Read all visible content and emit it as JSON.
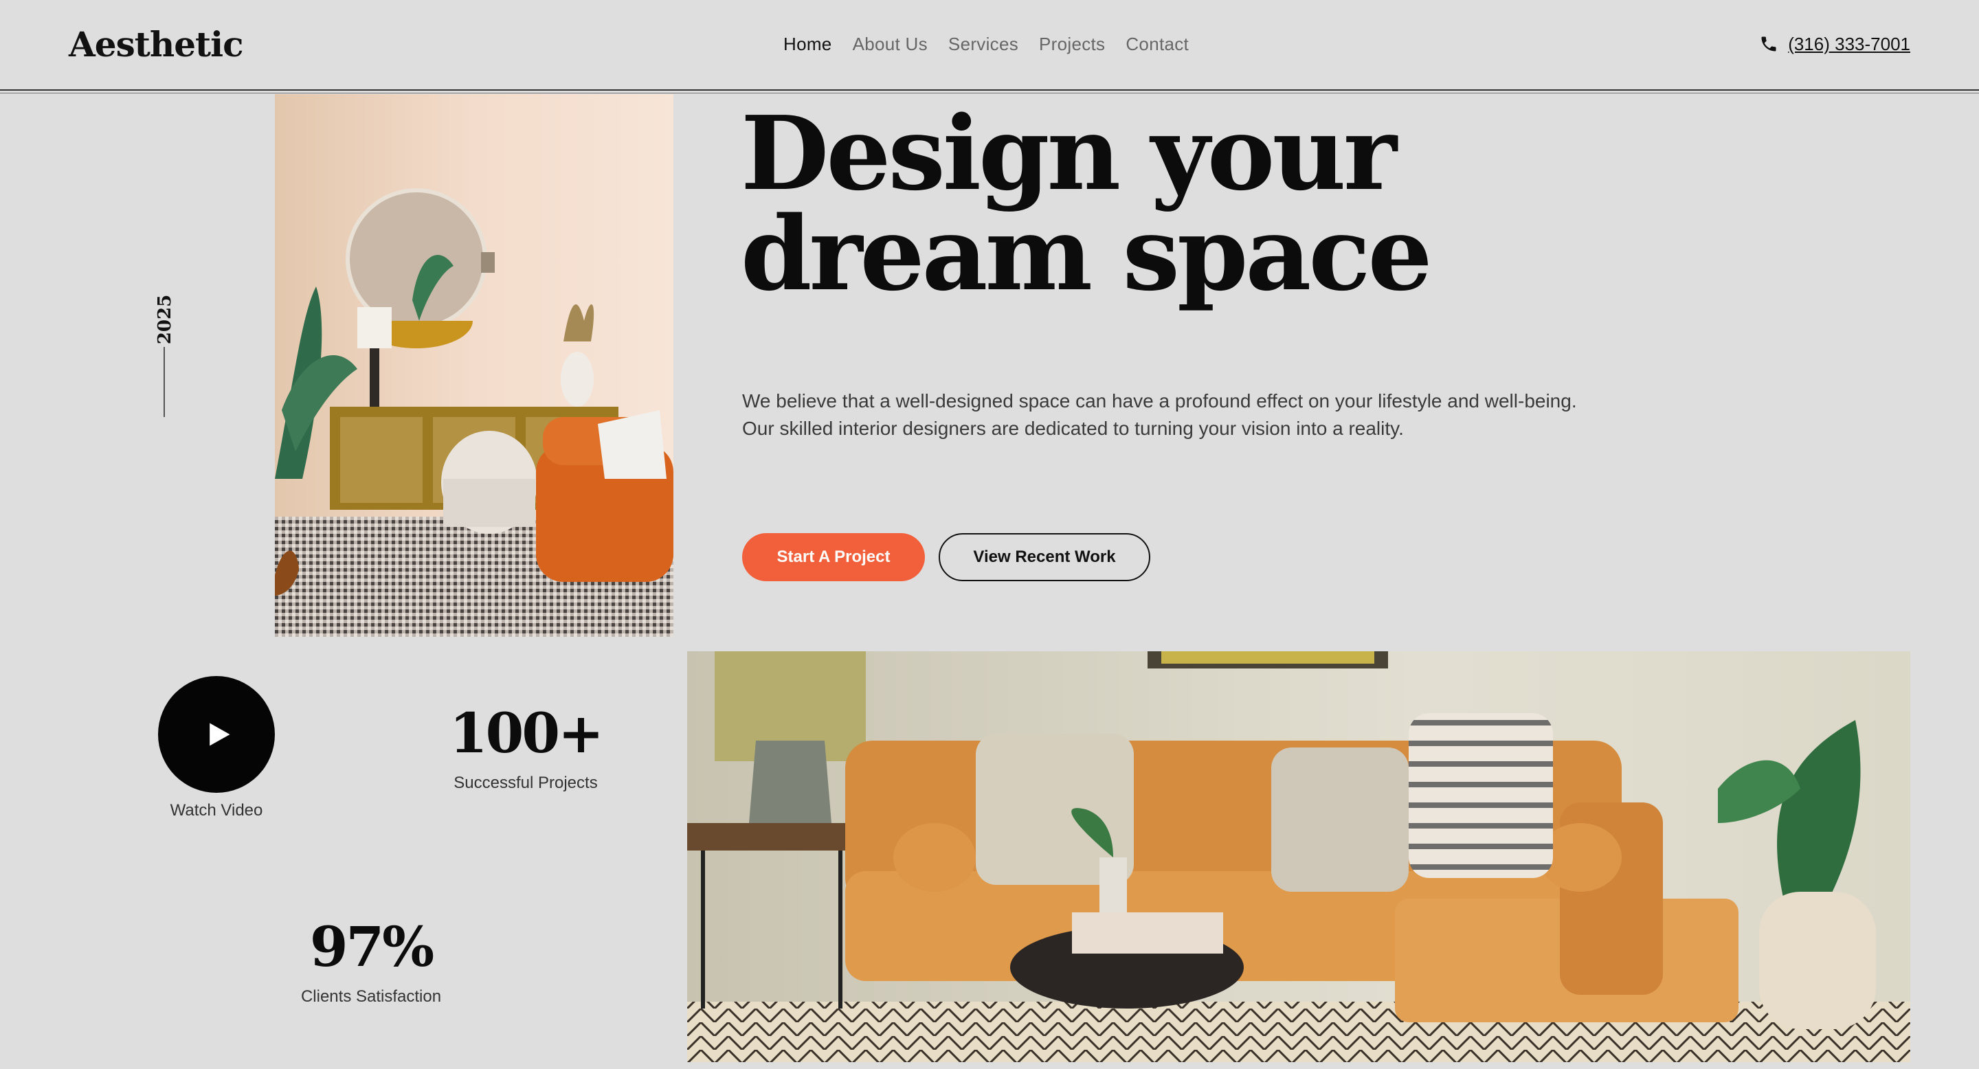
{
  "header": {
    "logo": "Aesthetic",
    "nav": [
      "Home",
      "About Us",
      "Services",
      "Projects",
      "Contact"
    ],
    "active_nav": "Home",
    "phone": "(316) 333-7001"
  },
  "hero": {
    "year": "2025",
    "headline_line1": "Design your",
    "headline_line2": "dream space",
    "lead_line1": "We believe that a well-designed space can have a profound effect on your lifestyle and well-being.",
    "lead_line2": "Our skilled interior designers are dedicated to turning your vision into a reality.",
    "primary_cta": "Start A Project",
    "secondary_cta": "View Recent Work"
  },
  "stats": {
    "watch_video": "Watch Video",
    "projects_value": "100+",
    "projects_label": "Successful Projects",
    "satisfaction_value": "97%",
    "satisfaction_label": "Clients Satisfaction"
  },
  "colors": {
    "background": "#dedede",
    "accent": "#f1603a",
    "text": "#111111"
  },
  "icons": [
    "phone-icon",
    "play-icon"
  ]
}
